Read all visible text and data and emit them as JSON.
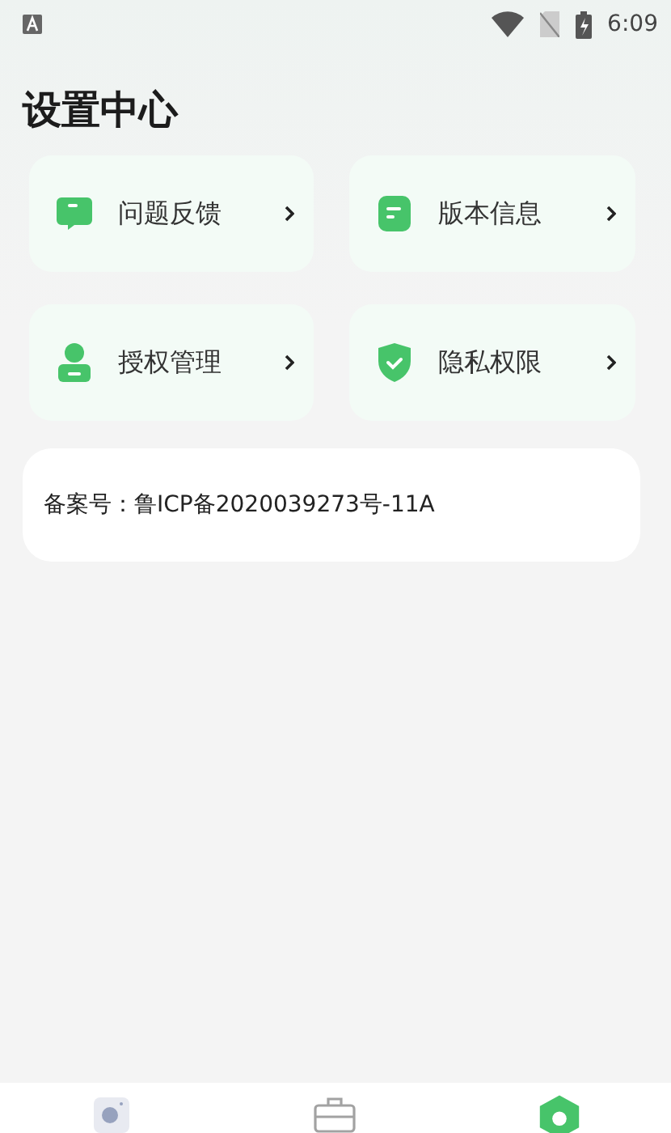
{
  "status_bar": {
    "time": "6:09"
  },
  "title": "设置中心",
  "menu": [
    {
      "label": "问题反馈",
      "kind": "feedback"
    },
    {
      "label": "版本信息",
      "kind": "version"
    },
    {
      "label": "授权管理",
      "kind": "auth"
    },
    {
      "label": "隐私权限",
      "kind": "privacy"
    }
  ],
  "icp": "备案号：鲁ICP备2020039273号-11A",
  "bottom_nav": [
    {
      "kind": "camera",
      "selected": false
    },
    {
      "kind": "toolbox",
      "selected": false
    },
    {
      "kind": "settings",
      "selected": true
    }
  ]
}
